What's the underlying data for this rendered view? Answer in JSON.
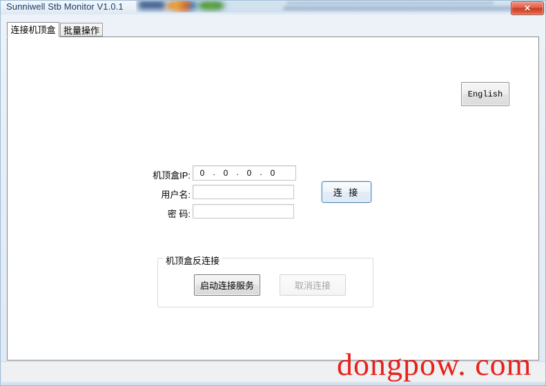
{
  "window": {
    "title": "Sunniwell Stb Monitor V1.0.1",
    "close_label": "✕"
  },
  "tabs": [
    {
      "label": "连接机顶盒",
      "active": true
    },
    {
      "label": "批量操作",
      "active": false
    }
  ],
  "toolbar": {
    "language_button": "English"
  },
  "form": {
    "ip_label": "机顶盒IP:",
    "username_label": "用户名:",
    "password_label": "密 码:",
    "ip_octets": [
      "0",
      "0",
      "0",
      "0"
    ],
    "ip_separator": ".",
    "username_value": "",
    "password_value": "",
    "connect_button": "连 接"
  },
  "reverse_connect_group": {
    "title": "机顶盒反连接",
    "start_service_button": "启动连接服务",
    "cancel_connect_button": "取消连接"
  },
  "watermark": {
    "text": "dongpow. com"
  },
  "colors": {
    "accent_blue": "#3c7fb1",
    "close_red": "#cf3a24",
    "watermark_red": "#e8211c",
    "title_text": "#1d3c63"
  }
}
